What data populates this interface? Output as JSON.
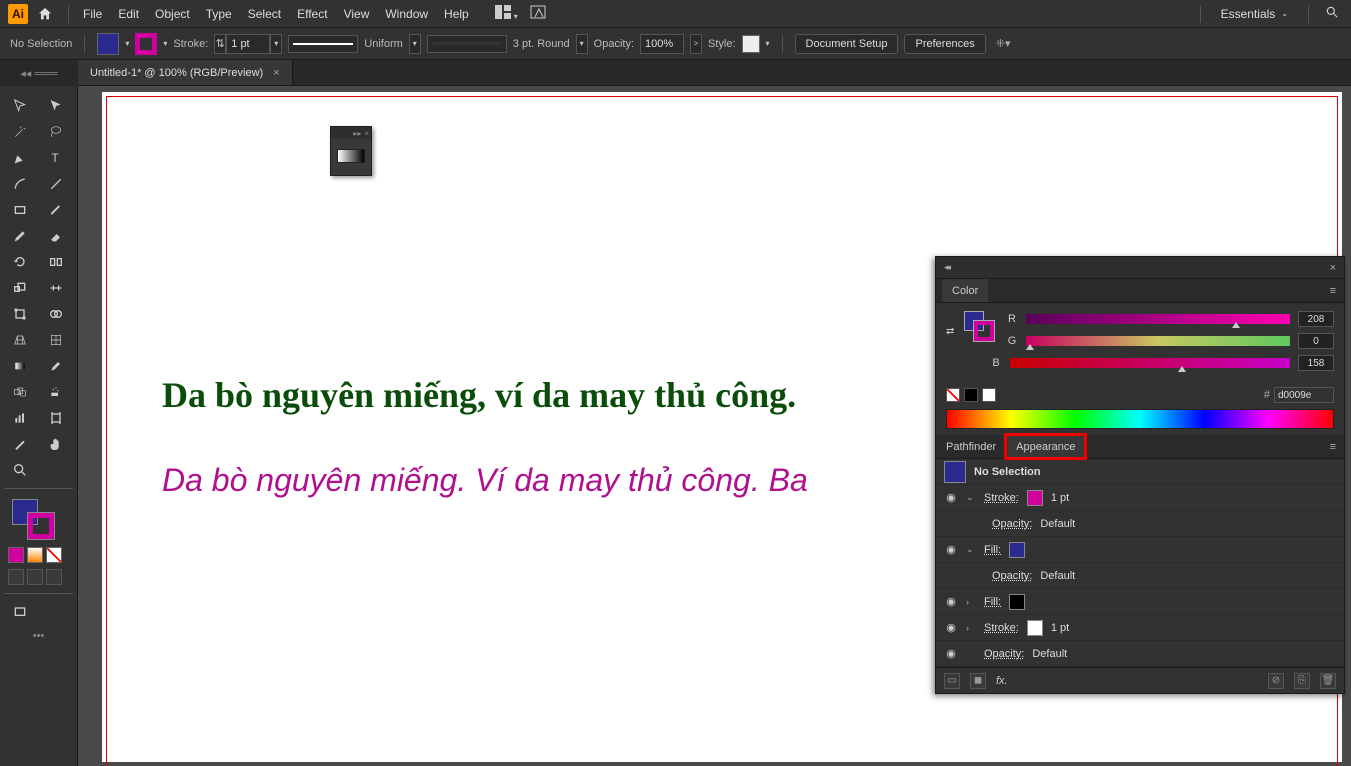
{
  "app": {
    "logo": "Ai"
  },
  "menu": [
    "File",
    "Edit",
    "Object",
    "Type",
    "Select",
    "Effect",
    "View",
    "Window",
    "Help"
  ],
  "workspace": "Essentials",
  "control": {
    "selection": "No Selection",
    "stroke_label": "Stroke:",
    "stroke_weight": "1 pt",
    "uniform": "Uniform",
    "brush": "3 pt. Round",
    "opacity_label": "Opacity:",
    "opacity": "100%",
    "style_label": "Style:",
    "doc_setup": "Document Setup",
    "preferences": "Preferences"
  },
  "tab": {
    "title": "Untitled-1* @ 100% (RGB/Preview)"
  },
  "canvas": {
    "text1": "Da bò nguyên miếng, ví da may thủ công.",
    "text2": "Da bò nguyên miếng. Ví da may thủ công. Ba"
  },
  "color_panel": {
    "title": "Color",
    "r": "R",
    "g": "G",
    "b": "B",
    "r_val": "208",
    "g_val": "0",
    "b_val": "158",
    "hex_sym": "#",
    "hex": "d0009e"
  },
  "appearance_panel": {
    "tab_pathfinder": "Pathfinder",
    "tab_appearance": "Appearance",
    "no_selection": "No Selection",
    "stroke": "Stroke:",
    "pt1": "1 pt",
    "opacity": "Opacity:",
    "default": "Default",
    "fill": "Fill:",
    "fx": "fx."
  }
}
